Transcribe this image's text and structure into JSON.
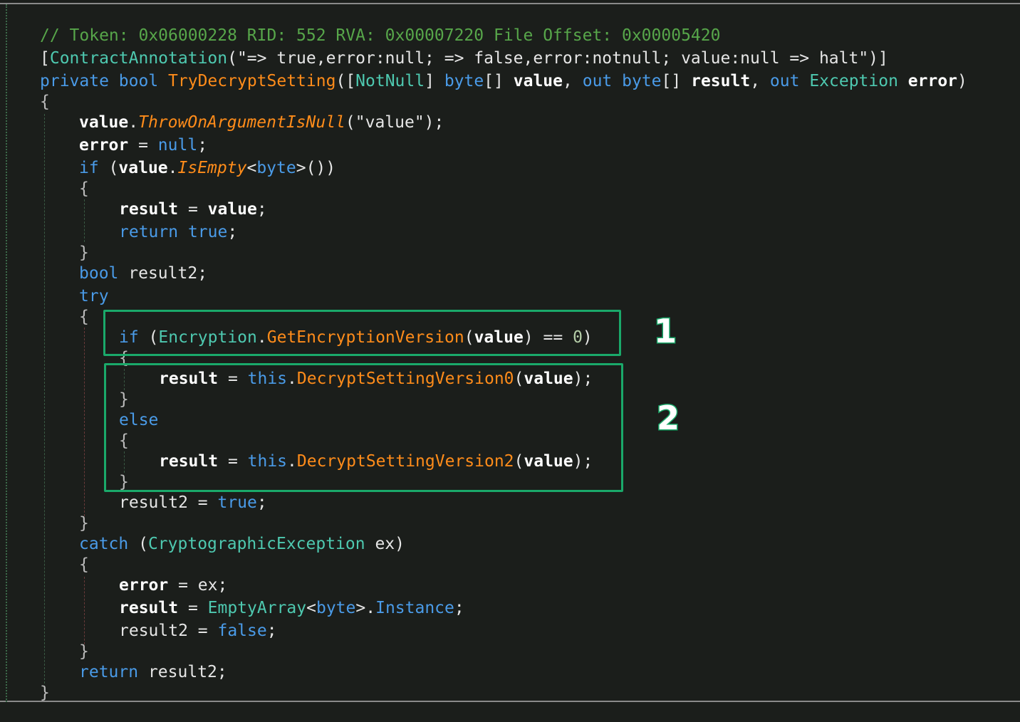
{
  "code": {
    "comment": "// Token: 0x06000228 RID: 552 RVA: 0x00007220 File Offset: 0x00005420",
    "attr_open": "[",
    "attr_name": "ContractAnnotation",
    "attr_args": "(\"=> true,error:null; => false,error:notnull; value:null => halt\")]",
    "sig_private": "private",
    "sig_bool": "bool",
    "sig_name": "TryDecryptSetting",
    "sig_p1_open": "([",
    "sig_notnull": "NotNull",
    "sig_p1_close": "]",
    "sig_byte": "byte",
    "sig_arr": "[]",
    "sig_value": "value",
    "sig_comma": ",",
    "sig_out": "out",
    "sig_result": "result",
    "sig_exception": "Exception",
    "sig_error": "error",
    "sig_close": ")",
    "ob": "{",
    "cb": "}",
    "l_value": "value",
    "l_dot": ".",
    "l_throw": "ThrowOnArgumentIsNull",
    "l_throw_args": "(\"value\");",
    "l_error": "error",
    "l_eq": " = ",
    "l_null": "null",
    "l_semi": ";",
    "l_if": "if",
    "l_paren_open": " (",
    "l_isempty": "IsEmpty",
    "l_lt": "<",
    "l_gt": ">",
    "l_call_close": "())",
    "l_result": "result",
    "l_return": "return",
    "l_true": "true",
    "l_false": "false",
    "l_bool": "bool",
    "l_result2": "result2",
    "l_try": "try",
    "l_encryption": "Encryption",
    "l_getver": "GetEncryptionVersion",
    "l_open": "(",
    "l_close": ")",
    "l_eqeq": " == ",
    "l_zero": "0",
    "l_this": "this",
    "l_dec0": "DecryptSettingVersion0",
    "l_dec2": "DecryptSettingVersion2",
    "l_callend": ");",
    "l_else": "else",
    "l_catch": "catch",
    "l_cryptoex": "CryptographicException",
    "l_ex": "ex",
    "l_emptyarray": "EmptyArray",
    "l_instance": "Instance"
  },
  "annotations": {
    "badge1": "1",
    "badge2": "2"
  },
  "colors": {
    "background": "#1b1e1b",
    "comment": "#57a64a",
    "keyword": "#4a9be8",
    "type": "#4ec9b0",
    "method": "#ff8c1a",
    "highlight": "#1aa96a"
  }
}
